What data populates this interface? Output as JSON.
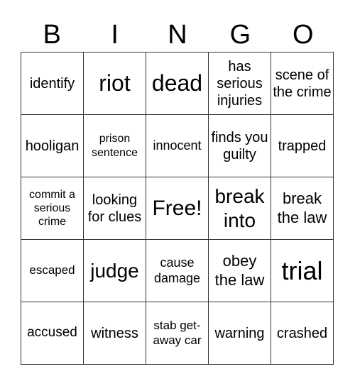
{
  "header": [
    "B",
    "I",
    "N",
    "G",
    "O"
  ],
  "cells": [
    [
      "identify",
      "riot",
      "dead",
      "has serious injuries",
      "scene of the crime"
    ],
    [
      "hooligan",
      "prison sentence",
      "innocent",
      "finds you guilty",
      "trapped"
    ],
    [
      "commit a serious crime",
      "looking for clues",
      "Free!",
      "break into",
      "break the law"
    ],
    [
      "escaped",
      "judge",
      "cause damage",
      "obey the law",
      "trial"
    ],
    [
      "accused",
      "witness",
      "stab get-away car",
      "warning",
      "crashed"
    ]
  ]
}
